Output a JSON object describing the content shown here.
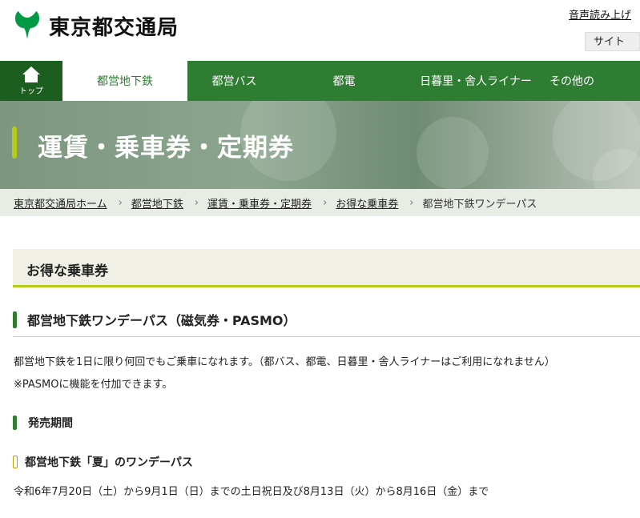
{
  "header": {
    "logo_text": "東京都交通局",
    "voice_link": "音声読み上げ",
    "sitemap_button": "サイト"
  },
  "nav": {
    "home_label": "トップ",
    "items": [
      "都営地下鉄",
      "都営バス",
      "都電",
      "日暮里・舎人ライナー",
      "その他の"
    ]
  },
  "banner": {
    "title": "運賃・乗車券・定期券"
  },
  "breadcrumb": {
    "links": [
      "東京都交通局ホーム",
      "都営地下鉄",
      "運賃・乗車券・定期券",
      "お得な乗車券"
    ],
    "current": "都営地下鉄ワンデーパス"
  },
  "section": {
    "title": "お得な乗車券"
  },
  "article": {
    "heading": "都営地下鉄ワンデーパス（磁気券・PASMO）",
    "paragraph1": "都営地下鉄を1日に限り何回でもご乗車になれます。（都バス、都電、日暮里・舎人ライナーはご利用になれません）",
    "paragraph2": "※PASMOに機能を付加できます。",
    "subheading": "発売期間",
    "subsubheading": "都営地下鉄「夏」のワンデーパス",
    "paragraph3": "令和6年7月20日（土）から9月1日（日）までの土日祝日及び8月13日（火）から8月16日（金）まで"
  },
  "colors": {
    "brand_green": "#2e7d32",
    "accent_lime": "#b5cc18",
    "accent_gold": "#b5a000"
  }
}
